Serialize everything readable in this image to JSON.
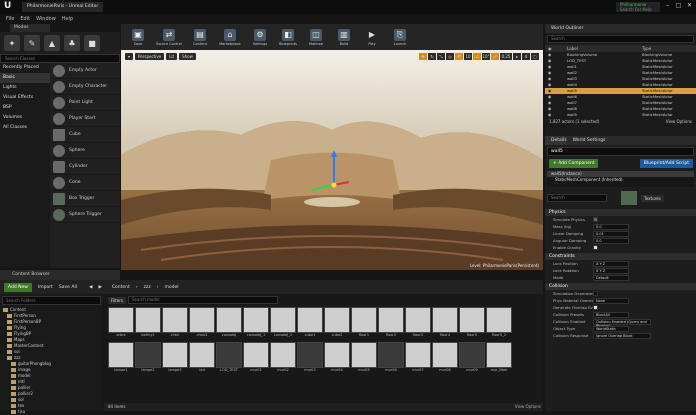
{
  "app": {
    "title": "PhilarmonieParis - Unreal Editor",
    "logo": "U"
  },
  "menu": [
    "File",
    "Edit",
    "Window",
    "Help"
  ],
  "user": {
    "project": "Philharmonie",
    "hint": "Search For Help"
  },
  "modes": {
    "tab_label": "Modes",
    "search_placeholder": "Search Classes",
    "icons": [
      "place-icon",
      "paint-icon",
      "landscape-icon",
      "foliage-icon",
      "geometry-icon"
    ],
    "categories": [
      "Recently Placed",
      "Basic",
      "Lights",
      "Visual Effects",
      "BSP",
      "Volumes",
      "All Classes"
    ],
    "active_category": "Basic",
    "items": [
      "Empty Actor",
      "Empty Character",
      "Point Light",
      "Player Start",
      "Cube",
      "Sphere",
      "Cylinder",
      "Cone",
      "Box Trigger",
      "Sphere Trigger"
    ]
  },
  "toolbar": {
    "buttons": [
      "Save",
      "Source Control",
      "Content",
      "Marketplace",
      "Settings",
      "Blueprints",
      "Matinee",
      "Build",
      "Play",
      "Launch"
    ]
  },
  "viewport": {
    "perspective": "Perspective",
    "lit": "Lit",
    "show": "Show",
    "grid_snap": "10",
    "rot_snap": "10°",
    "scale_snap": "0.25",
    "cam_speed": "4",
    "caption": "Level: PhilarmonieParis(Persistent)"
  },
  "content_browser": {
    "tab_label": "Content Browser",
    "add_new": "Add New",
    "import": "Import",
    "save_all": "Save All",
    "breadcrumb": [
      "Content",
      "zzz",
      "model"
    ],
    "filters": "Filters",
    "search_placeholder": "Search model",
    "folder_search_placeholder": "Search Folders",
    "folders": [
      "Content",
      "FirstPerson",
      "FirstPersonBP",
      "Flying",
      "FlyingBP",
      "Maps",
      "MasterContent",
      "sol",
      "zzz",
      "guitarPhongblog",
      "image",
      "model",
      "mtl",
      "pallier",
      "pallier2",
      "sol",
      "tex",
      "tisu"
    ],
    "row1_assets": [
      "arbre",
      "bariny2",
      "chair",
      "chair2",
      "consoleJ",
      "consoleJ_1",
      "consoleJ_2",
      "cube1",
      "cube2",
      "floor1",
      "floor2",
      "floor3",
      "floor4",
      "floor5",
      "floor5_2",
      "c_vinyl_int",
      "guitar_body",
      "groundPlane",
      "guitar_head",
      "hat"
    ],
    "row2_assets": [
      "lampe1",
      "lampe2",
      "lampe3",
      "lod",
      "LOD_TEST",
      "mur01",
      "mur02",
      "mur03",
      "mur04",
      "mur05",
      "mur06",
      "mur07",
      "mur08",
      "mur09",
      "mur_fiber",
      "mur_fiber_2",
      "mur_tasse",
      "mur_vitre"
    ],
    "status": "84 items",
    "view_options": "View Options"
  },
  "outliner": {
    "tab_label": "World Outliner",
    "search_placeholder": "Search",
    "col_label": "Label",
    "col_type": "Type",
    "rows": [
      {
        "label": "BlockingVolume",
        "type": "BlockingVolume"
      },
      {
        "label": "LOD_TEST",
        "type": "StaticMeshActor"
      },
      {
        "label": "wall1",
        "type": "StaticMeshActor"
      },
      {
        "label": "wall2",
        "type": "StaticMeshActor"
      },
      {
        "label": "wall3",
        "type": "StaticMeshActor"
      },
      {
        "label": "wall4",
        "type": "StaticMeshActor"
      },
      {
        "label": "wall5",
        "type": "StaticMeshActor"
      },
      {
        "label": "wall6",
        "type": "StaticMeshActor"
      },
      {
        "label": "wall7",
        "type": "StaticMeshActor"
      },
      {
        "label": "wall8",
        "type": "StaticMeshActor"
      },
      {
        "label": "wall9",
        "type": "StaticMeshActor"
      }
    ],
    "selected_index": 6,
    "footer": "1,827 actors (1 selected)",
    "view_options": "View Options"
  },
  "details": {
    "tab_details": "Details",
    "tab_world": "World Settings",
    "name": "wall5",
    "add_component": "+ Add Component",
    "blueprint": "Blueprint/Add Script",
    "components": [
      "wall5(Instance)",
      "StaticMeshComponent (Inherited)"
    ],
    "search_placeholder": "Search",
    "textures_btn": "Textures",
    "sections": {
      "physics": "Physics",
      "constraints": "Constraints",
      "collision": "Collision"
    },
    "physics_props": [
      {
        "label": "Simulate Physics",
        "value": "",
        "kind": "check-dim"
      },
      {
        "label": "Mass (kg)",
        "value": "0.0",
        "kind": "field"
      },
      {
        "label": "Linear Damping",
        "value": "0.01",
        "kind": "field"
      },
      {
        "label": "Angular Damping",
        "value": "0.0",
        "kind": "field"
      },
      {
        "label": "Enable Gravity",
        "value": "",
        "kind": "check-on"
      }
    ],
    "constraint_props": [
      {
        "label": "Lock Position",
        "value": "X Y Z",
        "kind": "field"
      },
      {
        "label": "Lock Rotation",
        "value": "X Y Z",
        "kind": "field"
      },
      {
        "label": "Mode",
        "value": "Default",
        "kind": "field"
      }
    ],
    "collision_props": [
      {
        "label": "Simulation Generates",
        "value": "",
        "kind": "check-off"
      },
      {
        "label": "Phys Material Override",
        "value": "None",
        "kind": "field"
      },
      {
        "label": "Generate Overlap Eve",
        "value": "",
        "kind": "check-on"
      },
      {
        "label": "Collision Presets",
        "value": "BlockAll",
        "kind": "field"
      },
      {
        "label": "Collision Enabled",
        "value": "Collision Enabled (Query and Physics)",
        "kind": "field"
      },
      {
        "label": "Object Type",
        "value": "WorldStatic",
        "kind": "field"
      },
      {
        "label": "Collision Response",
        "value": "Ignore  Overlap  Block",
        "kind": "field"
      }
    ]
  }
}
